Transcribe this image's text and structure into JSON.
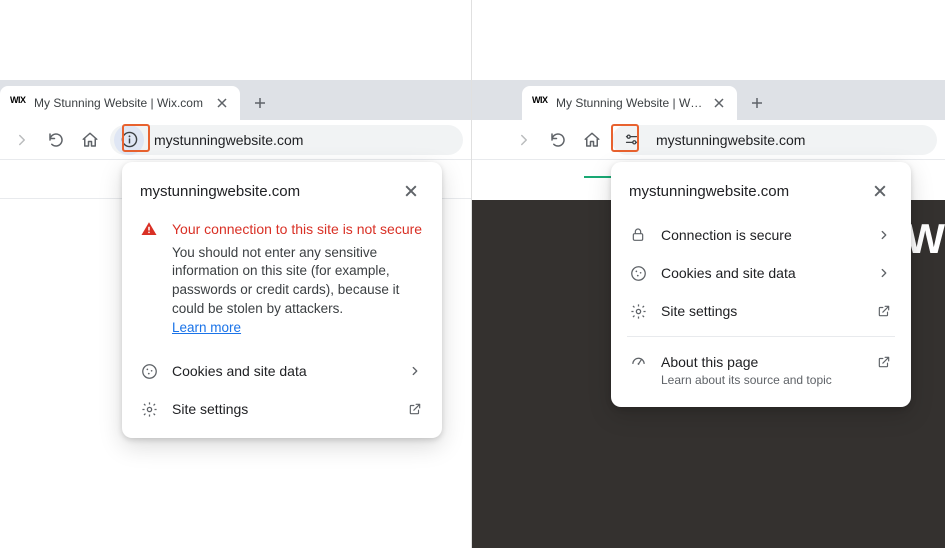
{
  "left": {
    "tab_title": "My Stunning Website | Wix.com",
    "favicon_text": "WIX",
    "url": "mystunningwebsite.com",
    "popup": {
      "title": "mystunningwebsite.com",
      "warning_title": "Your connection to this site is not secure",
      "warning_body": "You should not enter any sensitive information on this site (for example, passwords or credit cards), because it could be stolen by attackers.",
      "learn_more": "Learn more",
      "cookies": "Cookies and site data",
      "site_settings": "Site settings"
    }
  },
  "right": {
    "tab_title": "My Stunning Website | Wix.com",
    "favicon_text": "WIX",
    "url": "mystunningwebsite.com",
    "popup": {
      "title": "mystunningwebsite.com",
      "secure": "Connection is secure",
      "cookies": "Cookies and site data",
      "site_settings": "Site settings",
      "about": "About this page",
      "about_sub": "Learn about its source and topic"
    },
    "wix_mark": "W"
  }
}
